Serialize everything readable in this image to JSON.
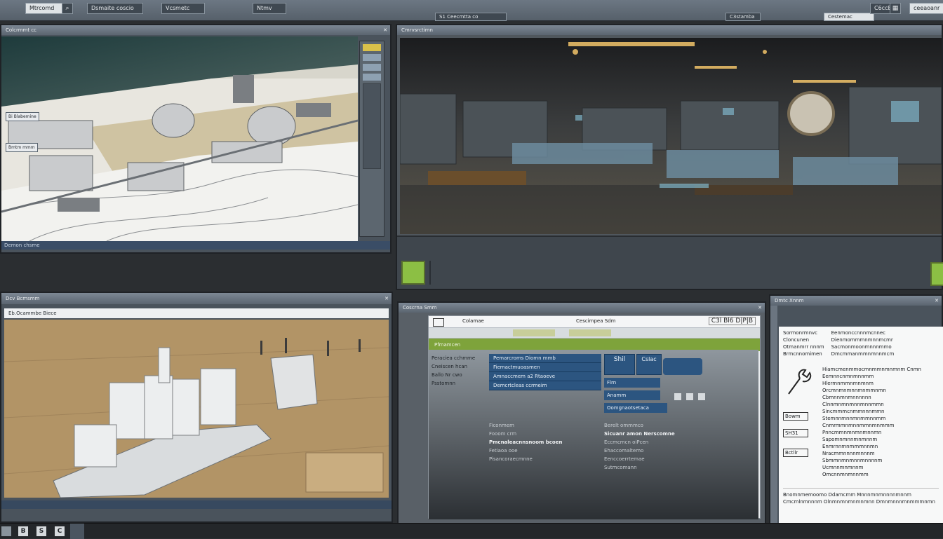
{
  "topbar": {
    "chip_a": "Mtrcomd",
    "chip_b": "Dsmaite coscio",
    "chip_c": "Vcsmetc",
    "chip_d": "Ntmv",
    "chip_e": "S1 Ceecmtta co",
    "chip_f": "C3stamba",
    "chip_g": "Cestemac",
    "chip_h": "C6ccBaam",
    "chip_i": "ceeaoanr",
    "icon_a": "search-icon",
    "icon_b": "grid-icon"
  },
  "panel_tl": {
    "title": "Colcrmmt cc",
    "status": "Demon chsme",
    "callout_1": "Bi Blabemine",
    "callout_2": "Bmtm mmm"
  },
  "panel_tr": {
    "title": "Cmrvsrctimn",
    "button_icon": "square-icon"
  },
  "panel_bl": {
    "title": "Dcv Bcmsmm",
    "address": "Eb.Ocammbe Biece"
  },
  "panel_bc": {
    "title": "Coscrna Smm",
    "window_title": "Cescimpea Sdm",
    "menu_label": "Colamae",
    "green_header": "Pfmamcen",
    "counter": "C3l Bl6 D|P|B",
    "left_list": [
      "Peraciea cchmme",
      "Cneiscen hcan",
      "Ballo Nr cwo",
      "Psstomnn"
    ],
    "blue_rows": [
      "Pemarcroms Diomn mmb",
      "Fiemactmuoasmen",
      "Amnaccmem a2 Rtaoeve",
      "Demcrtcleas ccrmeim"
    ],
    "mid_boxes": [
      "Shil",
      "Cslac",
      "Flrn",
      "Anamm",
      "Oomgnaotsetaca"
    ],
    "dark_lines": [
      "Ficonmem",
      "Fooom crm",
      "Pmcnaleacnnsnoom bcoen",
      "Fetiaoa ooe",
      "Pisancoraecmnne"
    ],
    "right_lines": [
      "Berelt ommmco",
      "Sicuanr amon Nerscomne",
      "Eccmcmcn oiPcen",
      "Ehaccomaltemo",
      "Eenccoerrtemae",
      "Sutmcomann"
    ]
  },
  "panel_br": {
    "title": "Dmtc Xnnm",
    "header_lines": [
      "Sormonrmnvc",
      "Cloncunen",
      "Otmanmrr nnnm",
      "Brmcnnomimen"
    ],
    "right_header": [
      "Eenmonccnnnmcnnec",
      "Dienmommmnmnnmcmr",
      "Sacmonmoonmnnnmmo",
      "Dmcmmanmmnmnnmcm"
    ],
    "body_lines": [
      "Hiamcmenmmocmnmmnmnmnm Cnmn",
      "Eemnncnmnmnnmm",
      "Hlermnmmnmnmnm",
      "Orcmnmnmnnmnmmnmn",
      "Cbmnnmnmnnnnnn",
      "Clnnmnmnmnnmnnmmn",
      "Sincmmmcnmmnnnmmn",
      "Stemnnmnnmnmmnnmm",
      "Cnmrmmnmnnmmnmnmmm",
      "Pnncmmnmnmnmnnmn",
      "Sapomnmnnmnmnnm",
      "Enmrnnmnmmmnnmn",
      "Nracmmnnnnmnnnm",
      "Sbmmnmnmnnmnnnnm",
      "Ucmnnmnmnnm",
      "Omcnnmnmnnmm"
    ],
    "tags": [
      "Bowm",
      "SH31",
      "Bctllr"
    ],
    "footer_1": "Bnomnmemoomo Ddamcmm Mnnnmnmnnnnmnnm",
    "footer_2": "Cmcmlnmnnnm Olnmnmnmnmnmnn Dmnmnnnmnmmmnmn"
  },
  "taskbar": {
    "items": [
      "B",
      "S",
      "C"
    ]
  }
}
